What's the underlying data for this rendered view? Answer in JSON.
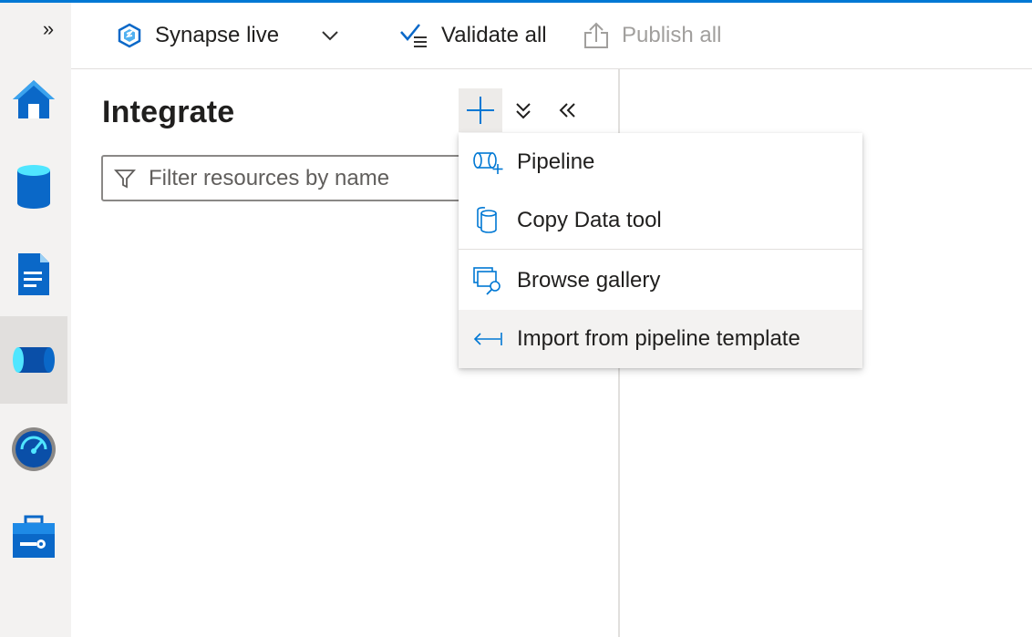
{
  "toolbar": {
    "workspace": "Synapse live",
    "validate": "Validate all",
    "publish": "Publish all"
  },
  "rail": {
    "items": [
      "home-icon",
      "data-icon",
      "develop-icon",
      "integrate-icon",
      "monitor-icon",
      "manage-icon"
    ],
    "active": "integrate-icon"
  },
  "pane": {
    "title": "Integrate",
    "filter_placeholder": "Filter resources by name"
  },
  "menu": {
    "items": [
      {
        "label": "Pipeline",
        "icon": "pipeline-icon"
      },
      {
        "label": "Copy Data tool",
        "icon": "copy-data-icon"
      },
      {
        "label": "Browse gallery",
        "icon": "gallery-icon"
      },
      {
        "label": "Import from pipeline template",
        "icon": "import-icon"
      }
    ],
    "hovered": "Import from pipeline template"
  },
  "colors": {
    "accent": "#0078d4",
    "rail_bg": "#f3f2f1",
    "rail_active": "#e1dfdd",
    "disabled_text": "#a19f9d"
  }
}
